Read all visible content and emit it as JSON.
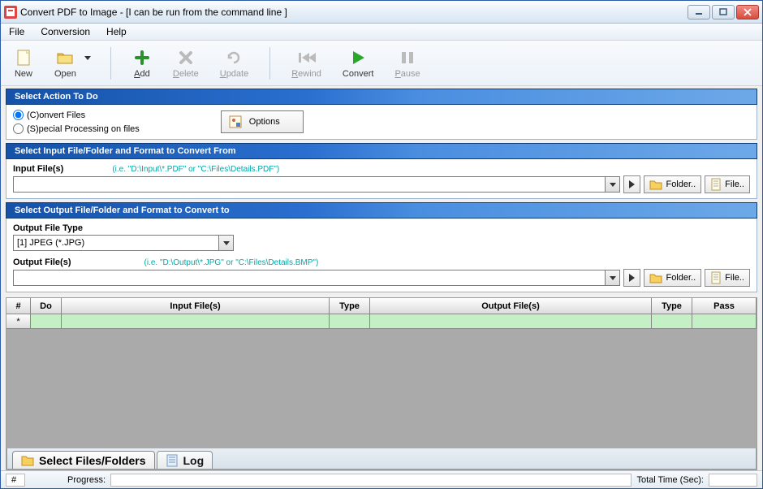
{
  "window": {
    "title": "Convert PDF to Image - [I can be run from the command line ]"
  },
  "menubar": {
    "file": "File",
    "conversion": "Conversion",
    "help": "Help"
  },
  "toolbar": {
    "new": "New",
    "open": "Open",
    "add": "Add",
    "delete": "Delete",
    "update": "Update",
    "rewind": "Rewind",
    "convert": "Convert",
    "pause": "Pause"
  },
  "sections": {
    "action": {
      "header": "Select Action To Do",
      "radio_convert": "(C)onvert Files",
      "radio_special": "(S)pecial Processing on files",
      "options_btn": "Options"
    },
    "input": {
      "header": "Select Input File/Folder and Format to Convert From",
      "label": "Input File(s)",
      "hint": "(i.e. \"D:\\Input\\*.PDF\"  or \"C:\\Files\\Details.PDF\")",
      "value": "",
      "folder_btn": "Folder..",
      "file_btn": "File.."
    },
    "output": {
      "header": "Select Output File/Folder and Format to Convert to",
      "type_label": "Output File Type",
      "type_value": "[1] JPEG (*.JPG)",
      "files_label": "Output File(s)",
      "files_hint": "(i.e. \"D:\\Output\\*.JPG\"  or \"C:\\Files\\Details.BMP\")",
      "files_value": "",
      "folder_btn": "Folder..",
      "file_btn": "File.."
    }
  },
  "grid": {
    "headers": [
      "#",
      "Do",
      "Input File(s)",
      "Type",
      "Output File(s)",
      "Type",
      "Pass"
    ],
    "row_marker": "*"
  },
  "tabs": {
    "select": "Select Files/Folders",
    "log": "Log"
  },
  "statusbar": {
    "hash": "#",
    "progress": "Progress:",
    "totaltime": "Total Time (Sec):"
  }
}
